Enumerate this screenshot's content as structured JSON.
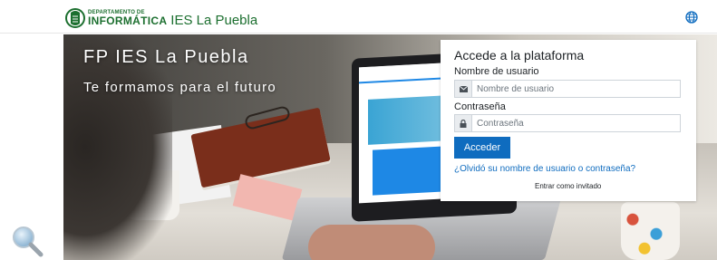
{
  "header": {
    "logo_dept": "DEPARTAMENTO DE",
    "logo_inf": "INFORMÁTICA",
    "logo_name": "IES La Puebla",
    "language_icon": "globe-icon"
  },
  "hero": {
    "title": "FP IES La Puebla",
    "subtitle": "Te formamos para el futuro"
  },
  "login": {
    "title": "Accede a la plataforma",
    "username_label": "Nombre de usuario",
    "username_placeholder": "Nombre de usuario",
    "username_icon": "envelope-icon",
    "password_label": "Contraseña",
    "password_placeholder": "Contraseña",
    "password_icon": "lock-icon",
    "submit_label": "Acceder",
    "forgot_link": "¿Olvidó su nombre de usuario o contraseña?",
    "guest_link": "Entrar como invitado"
  },
  "colors": {
    "brand_green": "#1c6f2f",
    "primary_blue": "#0f6cbf"
  },
  "widgets": {
    "search_icon": "magnifier-icon"
  }
}
